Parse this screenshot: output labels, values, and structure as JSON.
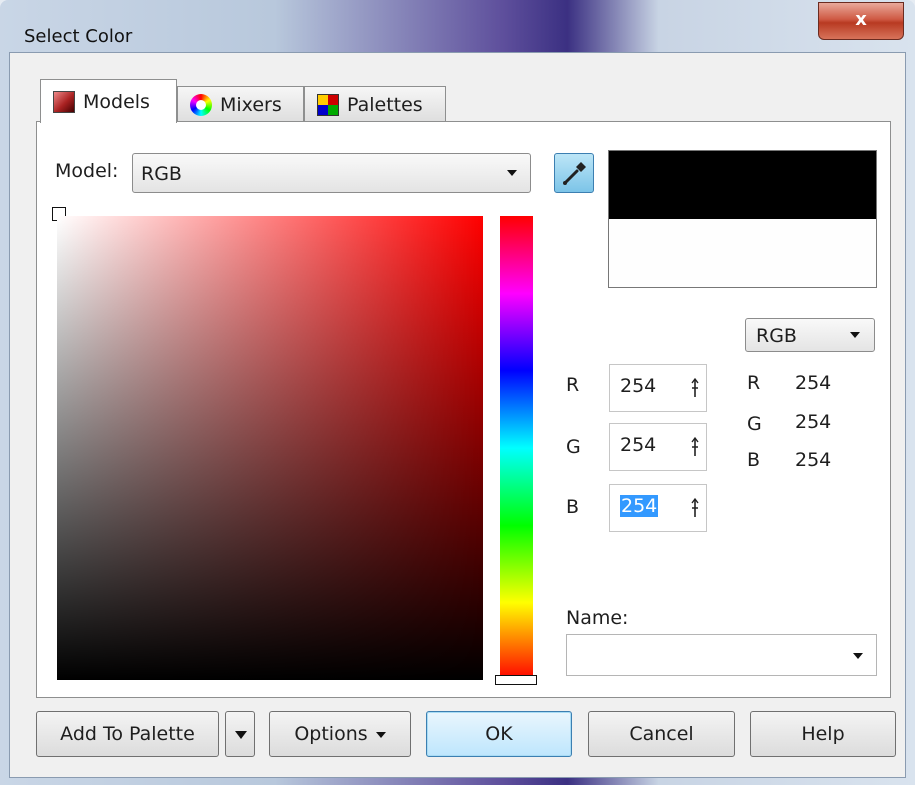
{
  "window": {
    "title": "Select Color",
    "close_glyph": "x"
  },
  "tabs": [
    {
      "label": "Models",
      "icon": "models-icon",
      "active": true
    },
    {
      "label": "Mixers",
      "icon": "mixers-icon",
      "active": false
    },
    {
      "label": "Palettes",
      "icon": "palettes-icon",
      "active": false
    }
  ],
  "model": {
    "label": "Model:",
    "value": "RGB"
  },
  "preview": {
    "old_color": "#000000",
    "new_color": "#fefefe"
  },
  "inputs": {
    "r": {
      "label": "R",
      "value": "254"
    },
    "g": {
      "label": "G",
      "value": "254"
    },
    "b": {
      "label": "B",
      "value": "254"
    }
  },
  "readout": {
    "model": "RGB",
    "r": {
      "label": "R",
      "value": "254"
    },
    "g": {
      "label": "G",
      "value": "254"
    },
    "b": {
      "label": "B",
      "value": "254"
    }
  },
  "name": {
    "label": "Name:",
    "value": ""
  },
  "buttons": {
    "add_to_palette": "Add To Palette",
    "options": "Options",
    "ok": "OK",
    "cancel": "Cancel",
    "help": "Help"
  },
  "colors": {
    "hue": "#ff0000",
    "selection": "#3399ff"
  }
}
